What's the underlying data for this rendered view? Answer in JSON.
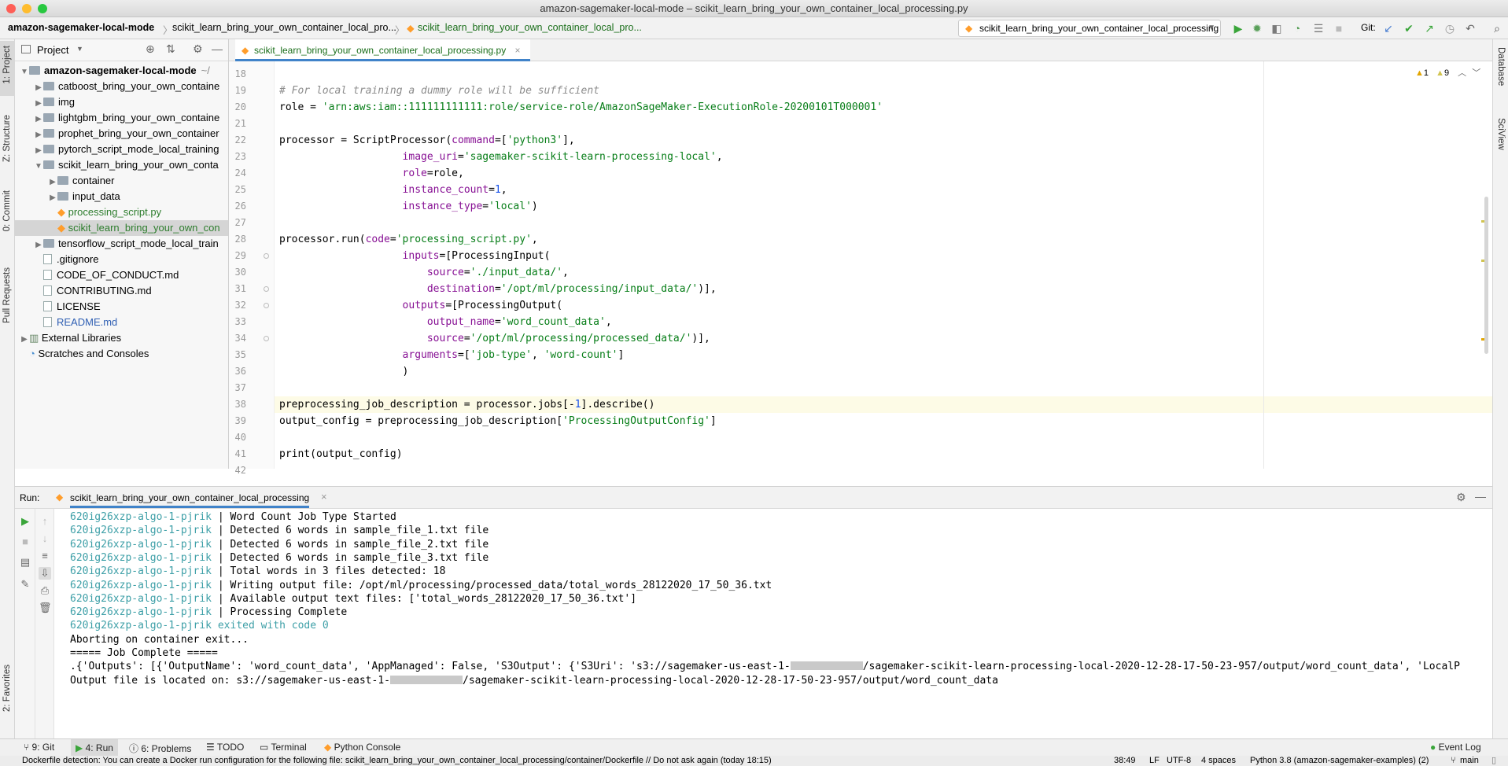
{
  "window": {
    "title": "amazon-sagemaker-local-mode – scikit_learn_bring_your_own_container_local_processing.py"
  },
  "breadcrumbs": [
    "amazon-sagemaker-local-mode",
    "scikit_learn_bring_your_own_container_local_pro...",
    "scikit_learn_bring_your_own_container_local_pro..."
  ],
  "toolbar": {
    "run_config": "scikit_learn_bring_your_own_container_local_processing",
    "git_label": "Git:"
  },
  "left_strip": {
    "project": "1: Project",
    "structure": "Z: Structure",
    "commit": "0: Commit",
    "pull_requests": "Pull Requests",
    "favorites": "2: Favorites"
  },
  "right_strip": {
    "database": "Database",
    "sciview": "SciView"
  },
  "project": {
    "header": "Project",
    "tree": [
      {
        "label": "amazon-sagemaker-local-mode",
        "suffix": "~/",
        "depth": 0,
        "type": "folder",
        "expanded": true,
        "bold": true
      },
      {
        "label": "catboost_bring_your_own_containe",
        "depth": 1,
        "type": "folder",
        "expanded": false
      },
      {
        "label": "img",
        "depth": 1,
        "type": "folder",
        "expanded": false
      },
      {
        "label": "lightgbm_bring_your_own_containe",
        "depth": 1,
        "type": "folder",
        "expanded": false
      },
      {
        "label": "prophet_bring_your_own_container",
        "depth": 1,
        "type": "folder",
        "expanded": false
      },
      {
        "label": "pytorch_script_mode_local_training",
        "depth": 1,
        "type": "folder",
        "expanded": false
      },
      {
        "label": "scikit_learn_bring_your_own_conta",
        "depth": 1,
        "type": "folder",
        "expanded": true
      },
      {
        "label": "container",
        "depth": 2,
        "type": "folder",
        "expanded": false
      },
      {
        "label": "input_data",
        "depth": 2,
        "type": "folder",
        "expanded": false
      },
      {
        "label": "processing_script.py",
        "depth": 2,
        "type": "py",
        "color": "#2d7d2d"
      },
      {
        "label": "scikit_learn_bring_your_own_con",
        "depth": 2,
        "type": "py",
        "color": "#2d7d2d",
        "selected": true
      },
      {
        "label": "tensorflow_script_mode_local_train",
        "depth": 1,
        "type": "folder",
        "expanded": false
      },
      {
        "label": ".gitignore",
        "depth": 1,
        "type": "file"
      },
      {
        "label": "CODE_OF_CONDUCT.md",
        "depth": 1,
        "type": "md"
      },
      {
        "label": "CONTRIBUTING.md",
        "depth": 1,
        "type": "md"
      },
      {
        "label": "LICENSE",
        "depth": 1,
        "type": "file"
      },
      {
        "label": "README.md",
        "depth": 1,
        "type": "md",
        "color": "#2f5fb3"
      },
      {
        "label": "External Libraries",
        "depth": 0,
        "type": "lib",
        "expanded": false
      },
      {
        "label": "Scratches and Consoles",
        "depth": 0,
        "type": "scratch"
      }
    ]
  },
  "editor": {
    "tab": "scikit_learn_bring_your_own_container_local_processing.py",
    "warnings": "1",
    "weak_warnings": "9",
    "current_line": 38,
    "lines": [
      {
        "n": "18",
        "code": ""
      },
      {
        "n": "19",
        "code": "# For local training a dummy role will be sufficient"
      },
      {
        "n": "20",
        "code": "role = 'arn:aws:iam::111111111111:role/service-role/AmazonSageMaker-ExecutionRole-20200101T000001'"
      },
      {
        "n": "21",
        "code": ""
      },
      {
        "n": "22",
        "code": "processor = ScriptProcessor(command=['python3'],"
      },
      {
        "n": "23",
        "code": "                    image_uri='sagemaker-scikit-learn-processing-local',"
      },
      {
        "n": "24",
        "code": "                    role=role,"
      },
      {
        "n": "25",
        "code": "                    instance_count=1,"
      },
      {
        "n": "26",
        "code": "                    instance_type='local')"
      },
      {
        "n": "27",
        "code": ""
      },
      {
        "n": "28",
        "code": "processor.run(code='processing_script.py',"
      },
      {
        "n": "29",
        "code": "                    inputs=[ProcessingInput("
      },
      {
        "n": "30",
        "code": "                        source='./input_data/',"
      },
      {
        "n": "31",
        "code": "                        destination='/opt/ml/processing/input_data/')],"
      },
      {
        "n": "32",
        "code": "                    outputs=[ProcessingOutput("
      },
      {
        "n": "33",
        "code": "                        output_name='word_count_data',"
      },
      {
        "n": "34",
        "code": "                        source='/opt/ml/processing/processed_data/')],"
      },
      {
        "n": "35",
        "code": "                    arguments=['job-type', 'word-count']"
      },
      {
        "n": "36",
        "code": "                    )"
      },
      {
        "n": "37",
        "code": ""
      },
      {
        "n": "38",
        "code": "preprocessing_job_description = processor.jobs[-1].describe()"
      },
      {
        "n": "39",
        "code": "output_config = preprocessing_job_description['ProcessingOutputConfig']"
      },
      {
        "n": "40",
        "code": ""
      },
      {
        "n": "41",
        "code": "print(output_config)"
      },
      {
        "n": "42",
        "code": ""
      }
    ]
  },
  "run": {
    "label": "Run:",
    "tab": "scikit_learn_bring_your_own_container_local_processing",
    "container": "620ig26xzp-algo-1-pjrik",
    "log": [
      {
        "prefix": true,
        "text": "Word Count Job Type Started"
      },
      {
        "prefix": true,
        "text": "Detected 6 words in sample_file_1.txt file"
      },
      {
        "prefix": true,
        "text": "Detected 6 words in sample_file_2.txt file"
      },
      {
        "prefix": true,
        "text": "Detected 6 words in sample_file_3.txt file"
      },
      {
        "prefix": true,
        "text": "Total words in 3 files detected: 18"
      },
      {
        "prefix": true,
        "text": "Writing output file: /opt/ml/processing/processed_data/total_words_28122020_17_50_36.txt"
      },
      {
        "prefix": true,
        "text": "Available output text files: ['total_words_28122020_17_50_36.txt']"
      },
      {
        "prefix": true,
        "text": "Processing Complete"
      },
      {
        "prefix": false,
        "exit": true,
        "text": "620ig26xzp-algo-1-pjrik exited with code 0"
      },
      {
        "prefix": false,
        "text": "Aborting on container exit..."
      },
      {
        "prefix": false,
        "text": "===== Job Complete ====="
      },
      {
        "prefix": false,
        "text_a": ".{'Outputs': [{'OutputName': 'word_count_data', 'AppManaged': False, 'S3Output': {'S3Uri': 's3://sagemaker-us-east-1-",
        "text_b": "/sagemaker-scikit-learn-processing-local-2020-12-28-17-50-23-957/output/word_count_data', 'LocalP"
      },
      {
        "prefix": false,
        "text_a": "Output file is located on: s3://sagemaker-us-east-1-",
        "text_b": "/sagemaker-scikit-learn-processing-local-2020-12-28-17-50-23-957/output/word_count_data"
      }
    ]
  },
  "tool_windows": {
    "git": "9: Git",
    "run": "4: Run",
    "problems": "6: Problems",
    "todo": "TODO",
    "terminal": "Terminal",
    "python_console": "Python Console",
    "event_log": "Event Log"
  },
  "status": {
    "message": "Dockerfile detection: You can create a Docker run configuration for the following file: scikit_learn_bring_your_own_container_local_processing/container/Dockerfile // Do not ask again (today 18:15)",
    "position": "38:49",
    "line_sep": "LF",
    "encoding": "UTF-8",
    "indent": "4 spaces",
    "interpreter": "Python 3.8 (amazon-sagemaker-examples) (2)",
    "branch": "main"
  }
}
